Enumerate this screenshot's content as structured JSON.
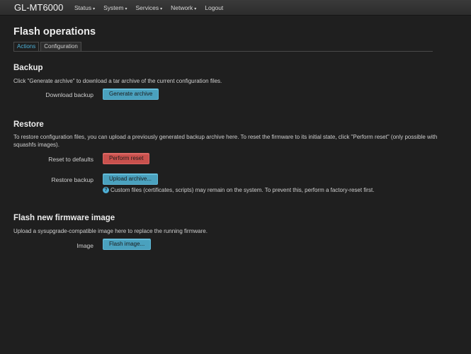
{
  "navbar": {
    "brand": "GL-MT6000",
    "menu": [
      {
        "label": "Status",
        "caret": "▾"
      },
      {
        "label": "System",
        "caret": "▾"
      },
      {
        "label": "Services",
        "caret": "▾"
      },
      {
        "label": "Network",
        "caret": "▾"
      },
      {
        "label": "Logout",
        "caret": ""
      }
    ]
  },
  "page": {
    "title": "Flash operations",
    "tabs": [
      {
        "label": "Actions",
        "active": true
      },
      {
        "label": "Configuration",
        "active": false
      }
    ]
  },
  "backup": {
    "title": "Backup",
    "description": "Click \"Generate archive\" to download a tar archive of the current configuration files.",
    "download_label": "Download backup",
    "generate_button": "Generate archive"
  },
  "restore": {
    "title": "Restore",
    "description": "To restore configuration files, you can upload a previously generated backup archive here. To reset the firmware to its initial state, click \"Perform reset\" (only possible with squashfs images).",
    "reset_label": "Reset to defaults",
    "reset_button": "Perform reset",
    "restore_label": "Restore backup",
    "upload_button": "Upload archive...",
    "help_icon": "?",
    "hint": "Custom files (certificates, scripts) may remain on the system. To prevent this, perform a factory-reset first."
  },
  "flash": {
    "title": "Flash new firmware image",
    "description": "Upload a sysupgrade-compatible image here to replace the running firmware.",
    "image_label": "Image",
    "flash_button": "Flash image..."
  }
}
